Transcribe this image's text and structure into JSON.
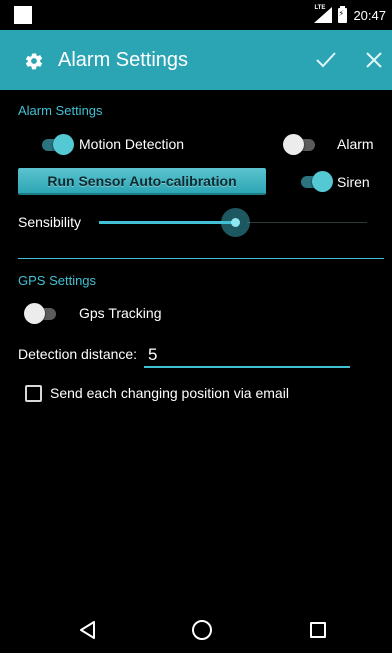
{
  "status_bar": {
    "network_label": "LTE",
    "time": "20:47"
  },
  "action_bar": {
    "title": "Alarm Settings",
    "icons": {
      "settings": "gear-icon",
      "confirm": "check-icon",
      "close": "close-icon"
    }
  },
  "alarm_section": {
    "title": "Alarm Settings",
    "motion_detection": {
      "label": "Motion Detection",
      "on": true
    },
    "alarm": {
      "label": "Alarm",
      "on": false
    },
    "calibrate_button": "Run Sensor Auto-calibration",
    "siren": {
      "label": "Siren",
      "on": true
    },
    "sensibility": {
      "label": "Sensibility",
      "value_fraction": 0.48
    }
  },
  "gps_section": {
    "title": "GPS Settings",
    "gps_tracking": {
      "label": "Gps Tracking",
      "on": false
    },
    "detection_distance": {
      "label": "Detection distance:",
      "value": "5"
    },
    "send_email": {
      "label": "Send each changing position via email",
      "checked": false
    }
  },
  "nav_bar": {
    "icons": {
      "back": "back-icon",
      "home": "home-icon",
      "recents": "recents-icon"
    }
  },
  "colors": {
    "accent": "#41c1d3",
    "action_bar": "#2ba4b4",
    "background": "#000000"
  }
}
